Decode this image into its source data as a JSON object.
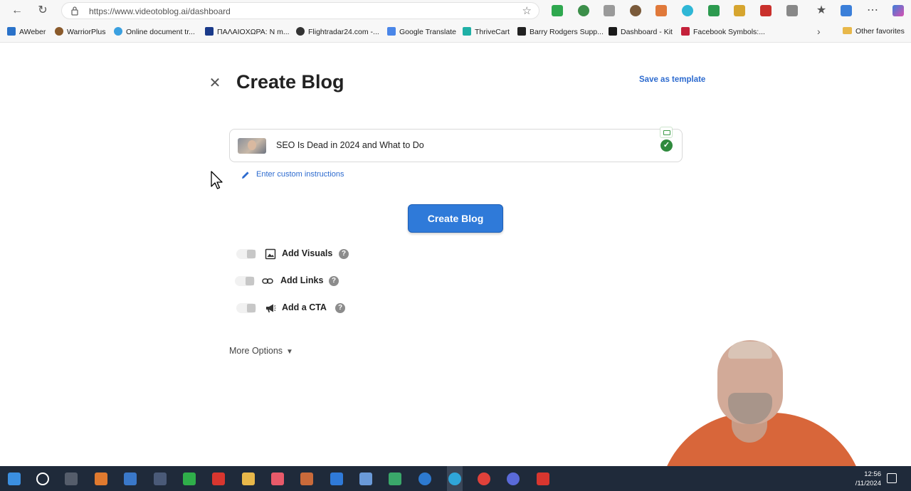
{
  "browser": {
    "url": "https://www.videotoblog.ai/dashboard",
    "bookmarks": [
      {
        "label": "AWeber",
        "icon": "aweber-icon",
        "color": "#2a72c9"
      },
      {
        "label": "WarriorPlus",
        "icon": "warriorplus-icon",
        "color": "#8a5a2b"
      },
      {
        "label": "Online document tr...",
        "icon": "document-translate-icon",
        "color": "#3aa0e0"
      },
      {
        "label": "ΠΑΛΑΙΟΧΩΡΑ: Ν m...",
        "icon": "m-logo-icon",
        "color": "#1a3a8a"
      },
      {
        "label": "Flightradar24.com -...",
        "icon": "flightradar-icon",
        "color": "#333333"
      },
      {
        "label": "Google Translate",
        "icon": "google-translate-icon",
        "color": "#4a86e8"
      },
      {
        "label": "ThriveCart",
        "icon": "thrivecart-icon",
        "color": "#1fb0a6"
      },
      {
        "label": "Barry Rodgers Supp...",
        "icon": "book-icon",
        "color": "#222222"
      },
      {
        "label": "Dashboard - Kit",
        "icon": "kit-icon",
        "color": "#1a1a1a"
      },
      {
        "label": "Facebook Symbols:...",
        "icon": "facebook-symbols-icon",
        "color": "#c4213a"
      }
    ],
    "other_favorites": "Other favorites"
  },
  "page": {
    "title": "Create Blog",
    "save_template": "Save as template",
    "video_title": "SEO Is Dead in 2024 and What to Do",
    "custom_instructions": "Enter custom instructions",
    "create_button": "Create Blog",
    "options": [
      {
        "label": "Add Visuals",
        "icon": "image-icon",
        "enabled": false
      },
      {
        "label": "Add Links",
        "icon": "link-icon",
        "enabled": false
      },
      {
        "label": "Add a CTA",
        "icon": "megaphone-icon",
        "enabled": false
      }
    ],
    "more_options": "More Options"
  },
  "taskbar": {
    "time": "12:56",
    "date": "/11/2024"
  },
  "colors": {
    "accent": "#2f7ad9",
    "link": "#2d6bcf",
    "success": "#2f8a3d"
  }
}
